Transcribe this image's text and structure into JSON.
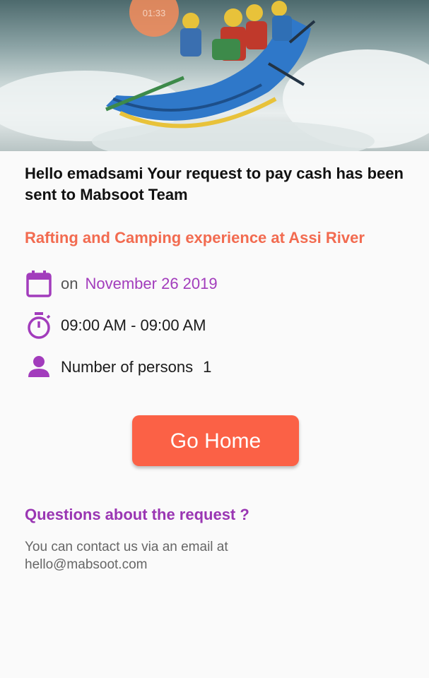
{
  "hero": {
    "timer_badge": "01:33"
  },
  "confirmation": {
    "headline": "Hello emadsami Your request to pay cash has been sent to Mabsoot Team",
    "experience_title": "Rafting and Camping experience at Assi River"
  },
  "details": {
    "date_prefix": "on",
    "date": "November 26 2019",
    "time": "09:00 AM - 09:00 AM",
    "persons_label": "Number of persons",
    "persons_count": "1"
  },
  "actions": {
    "go_home_label": "Go Home"
  },
  "help": {
    "title": "Questions about the request ?",
    "body": "You can contact us via an email at hello@mabsoot.com"
  },
  "colors": {
    "accent_orange": "#fb6146",
    "title_orange": "#f26b50",
    "accent_purple": "#9a36b3"
  },
  "icons": [
    "calendar-icon",
    "stopwatch-icon",
    "person-icon"
  ]
}
